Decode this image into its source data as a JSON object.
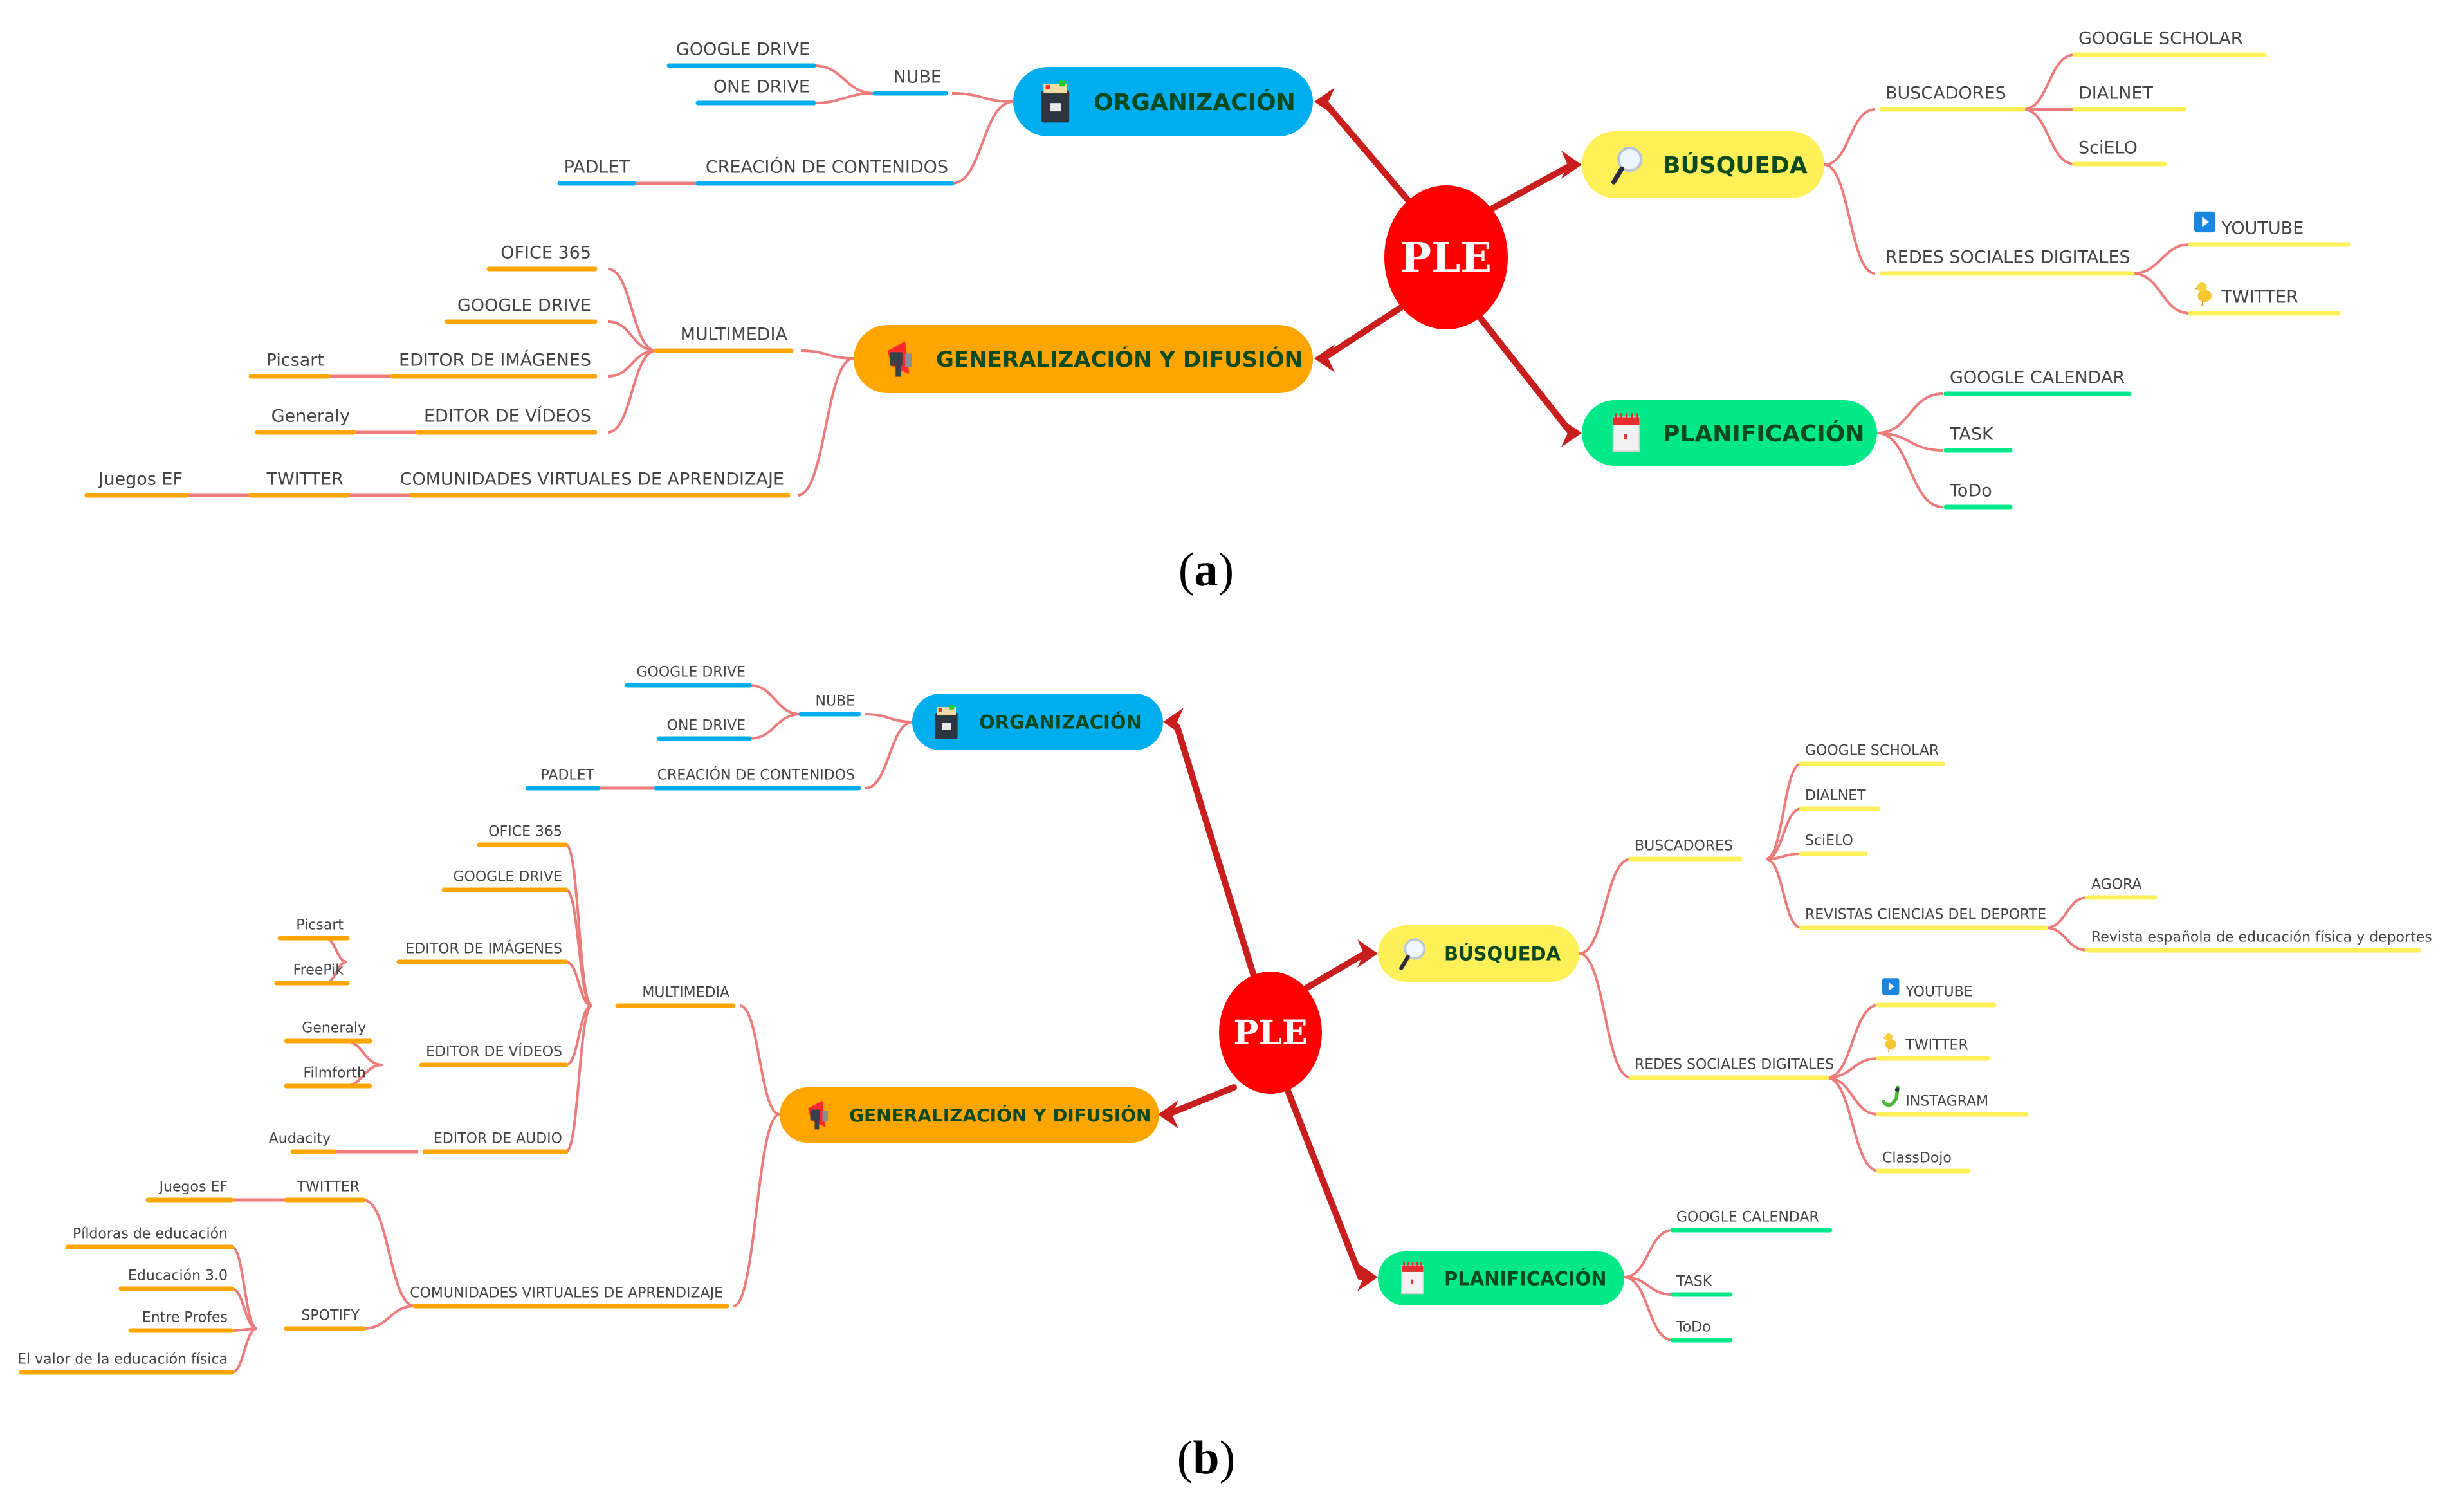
{
  "colors": {
    "center": "#ff0000",
    "main_link": "#c81e1e",
    "sub_link": "#ec7b7b",
    "organizacion": "#00aeef",
    "busqueda": "#fff05a",
    "generalizacion": "#ffa500",
    "planificacion": "#00e887",
    "main_text": "#0b4a1f",
    "leaf_text": "#444444"
  },
  "panel_a": {
    "caption_open": "(",
    "caption_letter": "a",
    "caption_close": ")",
    "center": "PLE",
    "organizacion": {
      "label": "ORGANIZACIÓN",
      "icon": "file-cabinet-icon",
      "nube": "NUBE",
      "google_drive": "GOOGLE DRIVE",
      "one_drive": "ONE DRIVE",
      "creacion": "CREACIÓN DE CONTENIDOS",
      "padlet": "PADLET"
    },
    "busqueda": {
      "label": "BÚSQUEDA",
      "icon": "magnifier-icon",
      "buscadores": "BUSCADORES",
      "google_scholar": "GOOGLE SCHOLAR",
      "dialnet": "DIALNET",
      "scielo": "SciELO",
      "redes": "REDES SOCIALES DIGITALES",
      "youtube": "YOUTUBE",
      "twitter": "TWITTER"
    },
    "generalizacion": {
      "label": "GENERALIZACIÓN Y DIFUSIÓN",
      "icon": "megaphone-icon",
      "multimedia": "MULTIMEDIA",
      "office": "OFICE 365",
      "google_drive": "GOOGLE DRIVE",
      "editor_img": "EDITOR DE IMÁGENES",
      "picsart": "Picsart",
      "editor_vid": "EDITOR DE VÍDEOS",
      "generaly": "Generaly",
      "comunidades": "COMUNIDADES VIRTUALES DE APRENDIZAJE",
      "twitter": "TWITTER",
      "juegos": "Juegos EF"
    },
    "planificacion": {
      "label": "PLANIFICACIÓN",
      "icon": "calendar-icon",
      "google_calendar": "GOOGLE CALENDAR",
      "task": "TASK",
      "todo": "ToDo"
    }
  },
  "panel_b": {
    "caption_open": "(",
    "caption_letter": "b",
    "caption_close": ")",
    "center": "PLE",
    "organizacion": {
      "label": "ORGANIZACIÓN",
      "icon": "file-cabinet-icon",
      "nube": "NUBE",
      "google_drive": "GOOGLE DRIVE",
      "one_drive": "ONE DRIVE",
      "creacion": "CREACIÓN DE CONTENIDOS",
      "padlet": "PADLET"
    },
    "busqueda": {
      "label": "BÚSQUEDA",
      "icon": "magnifier-icon",
      "buscadores": "BUSCADORES",
      "google_scholar": "GOOGLE SCHOLAR",
      "dialnet": "DIALNET",
      "scielo": "SciELO",
      "revistas": "REVISTAS CIENCIAS DEL DEPORTE",
      "agora": "AGORA",
      "revista_esp": "Revista española de educación física y deportes",
      "redes": "REDES SOCIALES DIGITALES",
      "youtube": "YOUTUBE",
      "twitter": "TWITTER",
      "instagram": "INSTAGRAM",
      "classdojo": "ClassDojo"
    },
    "generalizacion": {
      "label": "GENERALIZACIÓN Y DIFUSIÓN",
      "icon": "megaphone-icon",
      "multimedia": "MULTIMEDIA",
      "office": "OFICE 365",
      "google_drive": "GOOGLE DRIVE",
      "editor_img": "EDITOR DE IMÁGENES",
      "picsart": "Picsart",
      "freepik": "FreePik",
      "editor_vid": "EDITOR DE VÍDEOS",
      "generaly": "Generaly",
      "filmforth": "Filmforth",
      "editor_audio": "EDITOR DE AUDIO",
      "audacity": "Audacity",
      "comunidades": "COMUNIDADES VIRTUALES DE APRENDIZAJE",
      "twitter": "TWITTER",
      "juegos": "Juegos EF",
      "spotify": "SPOTIFY",
      "pildoras": "Píldoras de educación",
      "educacion30": "Educación 3.0",
      "entre_profes": "Entre Profes",
      "valor": "El valor de la educación física"
    },
    "planificacion": {
      "label": "PLANIFICACIÓN",
      "icon": "calendar-icon",
      "google_calendar": "GOOGLE CALENDAR",
      "task": "TASK",
      "todo": "ToDo"
    }
  }
}
